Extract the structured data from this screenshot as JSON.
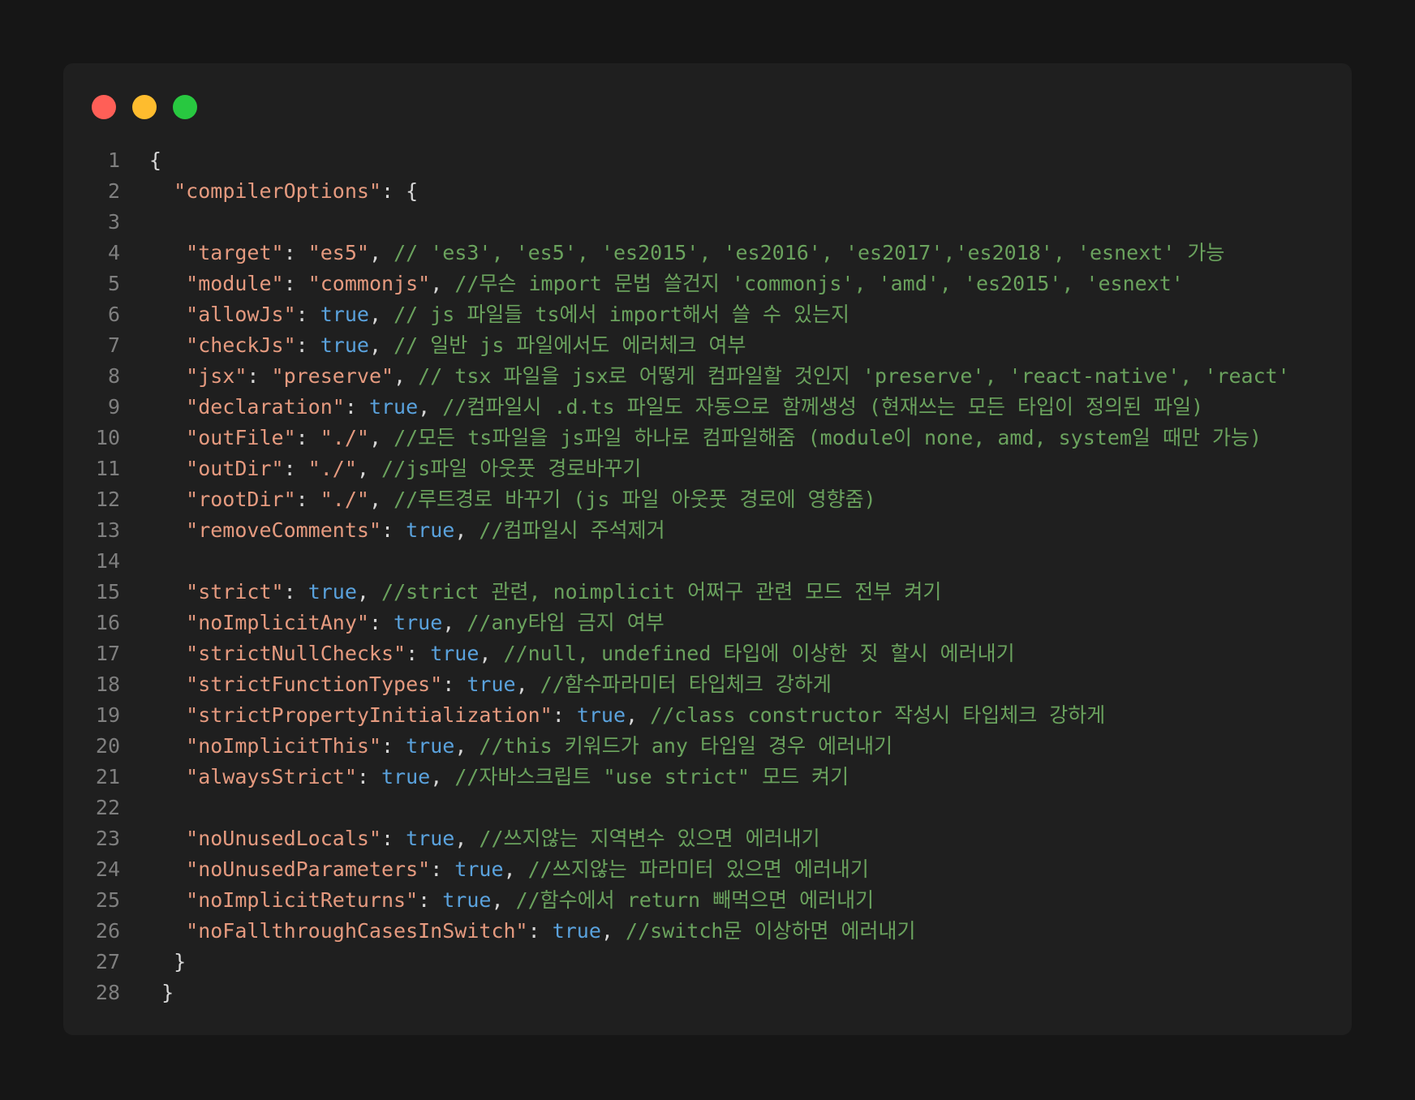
{
  "window": {
    "buttons": [
      {
        "name": "close",
        "color": "#ff5f57"
      },
      {
        "name": "minimize",
        "color": "#febc2e"
      },
      {
        "name": "zoom",
        "color": "#28c840"
      }
    ]
  },
  "theme": {
    "key": "#e59a7f",
    "string": "#e59a7f",
    "keyword": "#5aa2dd",
    "comment": "#6aa25d",
    "punct": "#d7d7d7",
    "line_number": "#7f7f7f"
  },
  "code": {
    "lines": [
      {
        "n": "1",
        "tokens": [
          {
            "t": "{",
            "c": "punct"
          }
        ]
      },
      {
        "n": "2",
        "tokens": [
          {
            "t": "  ",
            "c": "punct"
          },
          {
            "t": "\"compilerOptions\"",
            "c": "key"
          },
          {
            "t": ": {",
            "c": "punct"
          }
        ]
      },
      {
        "n": "3",
        "tokens": []
      },
      {
        "n": "4",
        "tokens": [
          {
            "t": "   ",
            "c": "punct"
          },
          {
            "t": "\"target\"",
            "c": "key"
          },
          {
            "t": ": ",
            "c": "punct"
          },
          {
            "t": "\"es5\"",
            "c": "string"
          },
          {
            "t": ", ",
            "c": "punct"
          },
          {
            "t": "// 'es3', 'es5', 'es2015', 'es2016', 'es2017','es2018', 'esnext' 가능",
            "c": "comment"
          }
        ]
      },
      {
        "n": "5",
        "tokens": [
          {
            "t": "   ",
            "c": "punct"
          },
          {
            "t": "\"module\"",
            "c": "key"
          },
          {
            "t": ": ",
            "c": "punct"
          },
          {
            "t": "\"commonjs\"",
            "c": "string"
          },
          {
            "t": ", ",
            "c": "punct"
          },
          {
            "t": "//무슨 import 문법 쓸건지 'commonjs', 'amd', 'es2015', 'esnext'",
            "c": "comment"
          }
        ]
      },
      {
        "n": "6",
        "tokens": [
          {
            "t": "   ",
            "c": "punct"
          },
          {
            "t": "\"allowJs\"",
            "c": "key"
          },
          {
            "t": ": ",
            "c": "punct"
          },
          {
            "t": "true",
            "c": "keyword"
          },
          {
            "t": ", ",
            "c": "punct"
          },
          {
            "t": "// js 파일들 ts에서 import해서 쓸 수 있는지",
            "c": "comment"
          }
        ]
      },
      {
        "n": "7",
        "tokens": [
          {
            "t": "   ",
            "c": "punct"
          },
          {
            "t": "\"checkJs\"",
            "c": "key"
          },
          {
            "t": ": ",
            "c": "punct"
          },
          {
            "t": "true",
            "c": "keyword"
          },
          {
            "t": ", ",
            "c": "punct"
          },
          {
            "t": "// 일반 js 파일에서도 에러체크 여부",
            "c": "comment"
          }
        ]
      },
      {
        "n": "8",
        "tokens": [
          {
            "t": "   ",
            "c": "punct"
          },
          {
            "t": "\"jsx\"",
            "c": "key"
          },
          {
            "t": ": ",
            "c": "punct"
          },
          {
            "t": "\"preserve\"",
            "c": "string"
          },
          {
            "t": ", ",
            "c": "punct"
          },
          {
            "t": "// tsx 파일을 jsx로 어떻게 컴파일할 것인지 'preserve', 'react-native', 'react'",
            "c": "comment"
          }
        ]
      },
      {
        "n": "9",
        "tokens": [
          {
            "t": "   ",
            "c": "punct"
          },
          {
            "t": "\"declaration\"",
            "c": "key"
          },
          {
            "t": ": ",
            "c": "punct"
          },
          {
            "t": "true",
            "c": "keyword"
          },
          {
            "t": ", ",
            "c": "punct"
          },
          {
            "t": "//컴파일시 .d.ts 파일도 자동으로 함께생성 (현재쓰는 모든 타입이 정의된 파일)",
            "c": "comment"
          }
        ]
      },
      {
        "n": "10",
        "tokens": [
          {
            "t": "   ",
            "c": "punct"
          },
          {
            "t": "\"outFile\"",
            "c": "key"
          },
          {
            "t": ": ",
            "c": "punct"
          },
          {
            "t": "\"./\"",
            "c": "string"
          },
          {
            "t": ", ",
            "c": "punct"
          },
          {
            "t": "//모든 ts파일을 js파일 하나로 컴파일해줌 (module이 none, amd, system일 때만 가능)",
            "c": "comment"
          }
        ]
      },
      {
        "n": "11",
        "tokens": [
          {
            "t": "   ",
            "c": "punct"
          },
          {
            "t": "\"outDir\"",
            "c": "key"
          },
          {
            "t": ": ",
            "c": "punct"
          },
          {
            "t": "\"./\"",
            "c": "string"
          },
          {
            "t": ", ",
            "c": "punct"
          },
          {
            "t": "//js파일 아웃풋 경로바꾸기",
            "c": "comment"
          }
        ]
      },
      {
        "n": "12",
        "tokens": [
          {
            "t": "   ",
            "c": "punct"
          },
          {
            "t": "\"rootDir\"",
            "c": "key"
          },
          {
            "t": ": ",
            "c": "punct"
          },
          {
            "t": "\"./\"",
            "c": "string"
          },
          {
            "t": ", ",
            "c": "punct"
          },
          {
            "t": "//루트경로 바꾸기 (js 파일 아웃풋 경로에 영향줌)",
            "c": "comment"
          }
        ]
      },
      {
        "n": "13",
        "tokens": [
          {
            "t": "   ",
            "c": "punct"
          },
          {
            "t": "\"removeComments\"",
            "c": "key"
          },
          {
            "t": ": ",
            "c": "punct"
          },
          {
            "t": "true",
            "c": "keyword"
          },
          {
            "t": ", ",
            "c": "punct"
          },
          {
            "t": "//컴파일시 주석제거",
            "c": "comment"
          }
        ]
      },
      {
        "n": "14",
        "tokens": []
      },
      {
        "n": "15",
        "tokens": [
          {
            "t": "   ",
            "c": "punct"
          },
          {
            "t": "\"strict\"",
            "c": "key"
          },
          {
            "t": ": ",
            "c": "punct"
          },
          {
            "t": "true",
            "c": "keyword"
          },
          {
            "t": ", ",
            "c": "punct"
          },
          {
            "t": "//strict 관련, noimplicit 어쩌구 관련 모드 전부 켜기",
            "c": "comment"
          }
        ]
      },
      {
        "n": "16",
        "tokens": [
          {
            "t": "   ",
            "c": "punct"
          },
          {
            "t": "\"noImplicitAny\"",
            "c": "key"
          },
          {
            "t": ": ",
            "c": "punct"
          },
          {
            "t": "true",
            "c": "keyword"
          },
          {
            "t": ", ",
            "c": "punct"
          },
          {
            "t": "//any타입 금지 여부",
            "c": "comment"
          }
        ]
      },
      {
        "n": "17",
        "tokens": [
          {
            "t": "   ",
            "c": "punct"
          },
          {
            "t": "\"strictNullChecks\"",
            "c": "key"
          },
          {
            "t": ": ",
            "c": "punct"
          },
          {
            "t": "true",
            "c": "keyword"
          },
          {
            "t": ", ",
            "c": "punct"
          },
          {
            "t": "//null, undefined 타입에 이상한 짓 할시 에러내기",
            "c": "comment"
          }
        ]
      },
      {
        "n": "18",
        "tokens": [
          {
            "t": "   ",
            "c": "punct"
          },
          {
            "t": "\"strictFunctionTypes\"",
            "c": "key"
          },
          {
            "t": ": ",
            "c": "punct"
          },
          {
            "t": "true",
            "c": "keyword"
          },
          {
            "t": ", ",
            "c": "punct"
          },
          {
            "t": "//함수파라미터 타입체크 강하게",
            "c": "comment"
          }
        ]
      },
      {
        "n": "19",
        "tokens": [
          {
            "t": "   ",
            "c": "punct"
          },
          {
            "t": "\"strictPropertyInitialization\"",
            "c": "key"
          },
          {
            "t": ": ",
            "c": "punct"
          },
          {
            "t": "true",
            "c": "keyword"
          },
          {
            "t": ", ",
            "c": "punct"
          },
          {
            "t": "//class constructor 작성시 타입체크 강하게",
            "c": "comment"
          }
        ]
      },
      {
        "n": "20",
        "tokens": [
          {
            "t": "   ",
            "c": "punct"
          },
          {
            "t": "\"noImplicitThis\"",
            "c": "key"
          },
          {
            "t": ": ",
            "c": "punct"
          },
          {
            "t": "true",
            "c": "keyword"
          },
          {
            "t": ", ",
            "c": "punct"
          },
          {
            "t": "//this 키워드가 any 타입일 경우 에러내기",
            "c": "comment"
          }
        ]
      },
      {
        "n": "21",
        "tokens": [
          {
            "t": "   ",
            "c": "punct"
          },
          {
            "t": "\"alwaysStrict\"",
            "c": "key"
          },
          {
            "t": ": ",
            "c": "punct"
          },
          {
            "t": "true",
            "c": "keyword"
          },
          {
            "t": ", ",
            "c": "punct"
          },
          {
            "t": "//자바스크립트 \"use strict\" 모드 켜기",
            "c": "comment"
          }
        ]
      },
      {
        "n": "22",
        "tokens": []
      },
      {
        "n": "23",
        "tokens": [
          {
            "t": "   ",
            "c": "punct"
          },
          {
            "t": "\"noUnusedLocals\"",
            "c": "key"
          },
          {
            "t": ": ",
            "c": "punct"
          },
          {
            "t": "true",
            "c": "keyword"
          },
          {
            "t": ", ",
            "c": "punct"
          },
          {
            "t": "//쓰지않는 지역변수 있으면 에러내기",
            "c": "comment"
          }
        ]
      },
      {
        "n": "24",
        "tokens": [
          {
            "t": "   ",
            "c": "punct"
          },
          {
            "t": "\"noUnusedParameters\"",
            "c": "key"
          },
          {
            "t": ": ",
            "c": "punct"
          },
          {
            "t": "true",
            "c": "keyword"
          },
          {
            "t": ", ",
            "c": "punct"
          },
          {
            "t": "//쓰지않는 파라미터 있으면 에러내기",
            "c": "comment"
          }
        ]
      },
      {
        "n": "25",
        "tokens": [
          {
            "t": "   ",
            "c": "punct"
          },
          {
            "t": "\"noImplicitReturns\"",
            "c": "key"
          },
          {
            "t": ": ",
            "c": "punct"
          },
          {
            "t": "true",
            "c": "keyword"
          },
          {
            "t": ", ",
            "c": "punct"
          },
          {
            "t": "//함수에서 return 빼먹으면 에러내기",
            "c": "comment"
          }
        ]
      },
      {
        "n": "26",
        "tokens": [
          {
            "t": "   ",
            "c": "punct"
          },
          {
            "t": "\"noFallthroughCasesInSwitch\"",
            "c": "key"
          },
          {
            "t": ": ",
            "c": "punct"
          },
          {
            "t": "true",
            "c": "keyword"
          },
          {
            "t": ", ",
            "c": "punct"
          },
          {
            "t": "//switch문 이상하면 에러내기",
            "c": "comment"
          }
        ]
      },
      {
        "n": "27",
        "tokens": [
          {
            "t": "  ",
            "c": "punct"
          },
          {
            "t": "}",
            "c": "punct"
          }
        ]
      },
      {
        "n": "28",
        "tokens": [
          {
            "t": " ",
            "c": "punct"
          },
          {
            "t": "}",
            "c": "punct"
          }
        ]
      }
    ]
  }
}
